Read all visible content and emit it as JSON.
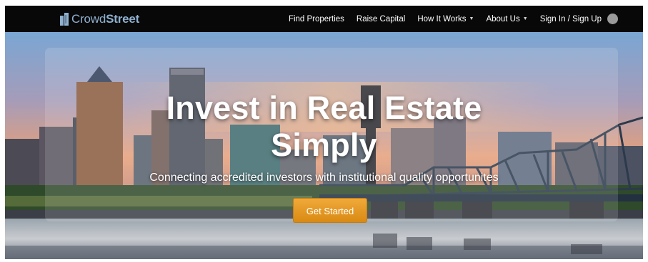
{
  "brand": {
    "name_part1": "Crowd",
    "name_part2": "Street"
  },
  "nav": {
    "items": [
      {
        "label": "Find Properties",
        "dropdown": false
      },
      {
        "label": "Raise Capital",
        "dropdown": false
      },
      {
        "label": "How It Works",
        "dropdown": true
      },
      {
        "label": "About Us",
        "dropdown": true
      },
      {
        "label": "Sign In / Sign Up",
        "dropdown": false
      }
    ],
    "caret_glyph": "▼"
  },
  "hero": {
    "headline_line1": "Invest in Real Estate",
    "headline_line2": "Simply",
    "subheadline": "Connecting accredited investors with institutional quality opportunites",
    "cta_label": "Get Started"
  },
  "colors": {
    "nav_bg": "#080808",
    "brand_blue": "#8fb0cf",
    "cta_orange": "#e39a26"
  }
}
